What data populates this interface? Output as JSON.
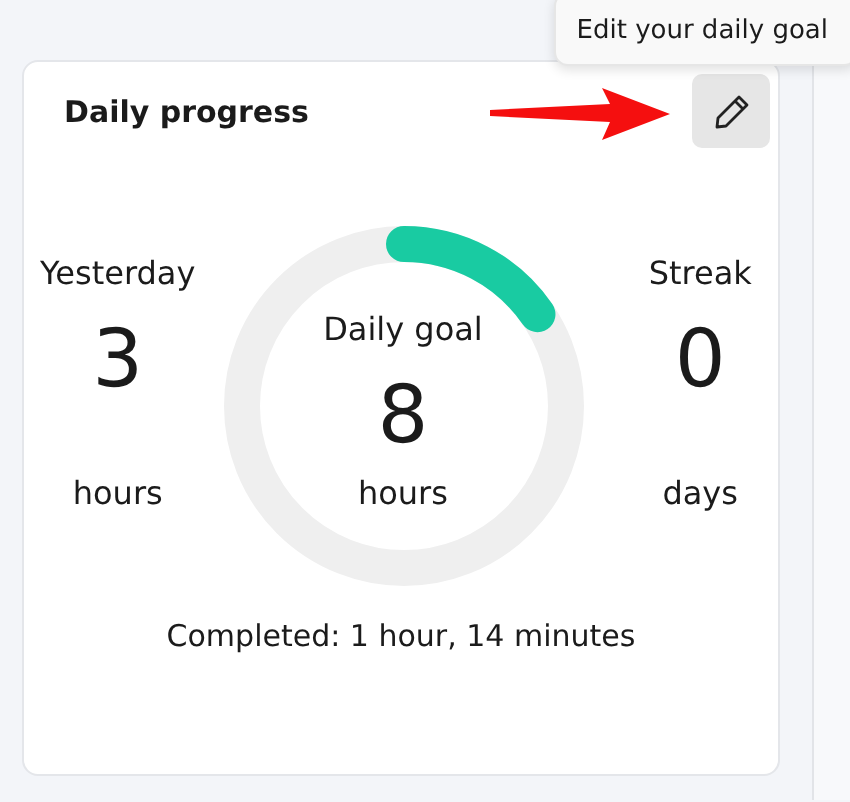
{
  "tooltip": {
    "text": "Edit your daily goal"
  },
  "card": {
    "title": "Daily progress",
    "stats": [
      {
        "kind": "side",
        "label": "Yesterday",
        "value": "3",
        "unit": "hours"
      },
      {
        "kind": "goal",
        "label": "Daily goal",
        "value": "8",
        "unit": "hours"
      },
      {
        "kind": "side",
        "label": "Streak",
        "value": "0",
        "unit": "days"
      }
    ],
    "completed": "Completed: 1 hour, 14 minutes"
  }
}
